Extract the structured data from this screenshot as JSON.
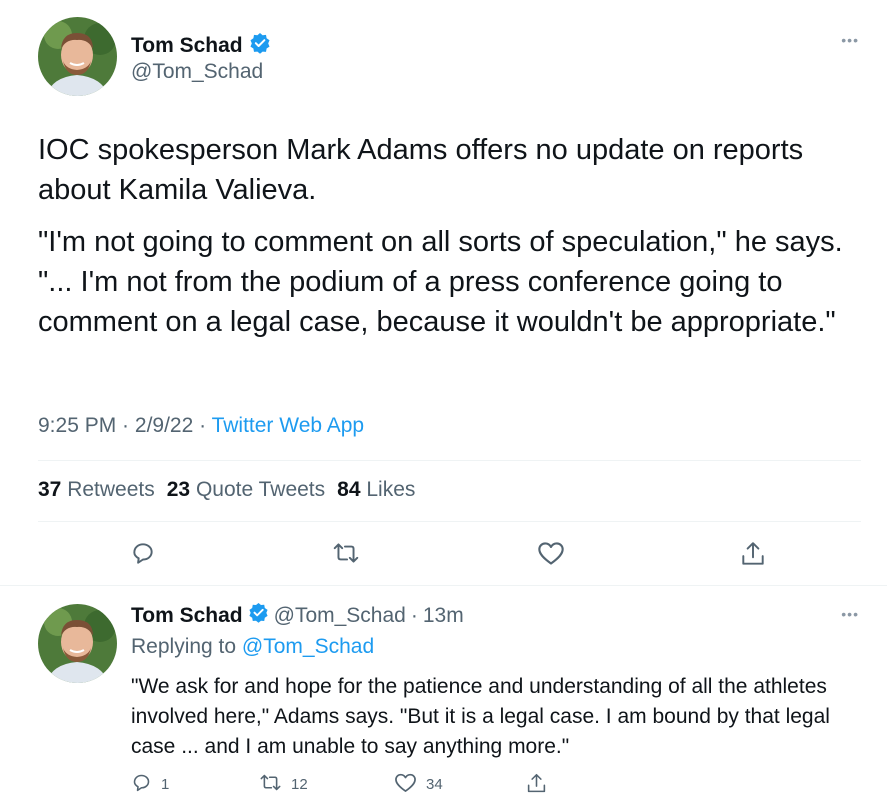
{
  "main_tweet": {
    "author": {
      "name": "Tom Schad",
      "handle": "@Tom_Schad",
      "verified": true
    },
    "text": [
      "IOC spokesperson Mark Adams offers no update on reports about Kamila Valieva.",
      "\"I'm not going to comment on all sorts of speculation,\" he says. \"... I'm not from the podium of a press conference going to comment on a legal case, because it wouldn't be appropriate.\""
    ],
    "time": "9:25 PM",
    "date": "2/9/22",
    "source": "Twitter Web App",
    "stats": {
      "retweets_count": "37",
      "retweets_label": "Retweets",
      "quotes_count": "23",
      "quotes_label": "Quote Tweets",
      "likes_count": "84",
      "likes_label": "Likes"
    },
    "actions": [
      "reply-icon",
      "retweet-icon",
      "like-icon",
      "share-icon"
    ]
  },
  "reply_tweet": {
    "author": {
      "name": "Tom Schad",
      "handle": "@Tom_Schad",
      "verified": true
    },
    "time_ago": "13m",
    "replying_to_label": "Replying to",
    "replying_to_handle": "@Tom_Schad",
    "text": "\"We ask for and hope for the patience and understanding of all the athletes involved here,\" Adams says. \"But it is a legal case. I am bound by that legal case ... and I am unable to say anything more.\"",
    "counts": {
      "replies": "1",
      "retweets": "12",
      "likes": "34"
    }
  },
  "colors": {
    "accent": "#1d9bf0",
    "secondary_text": "#536471",
    "primary_text": "#0f1419",
    "divider": "#eff3f4"
  }
}
